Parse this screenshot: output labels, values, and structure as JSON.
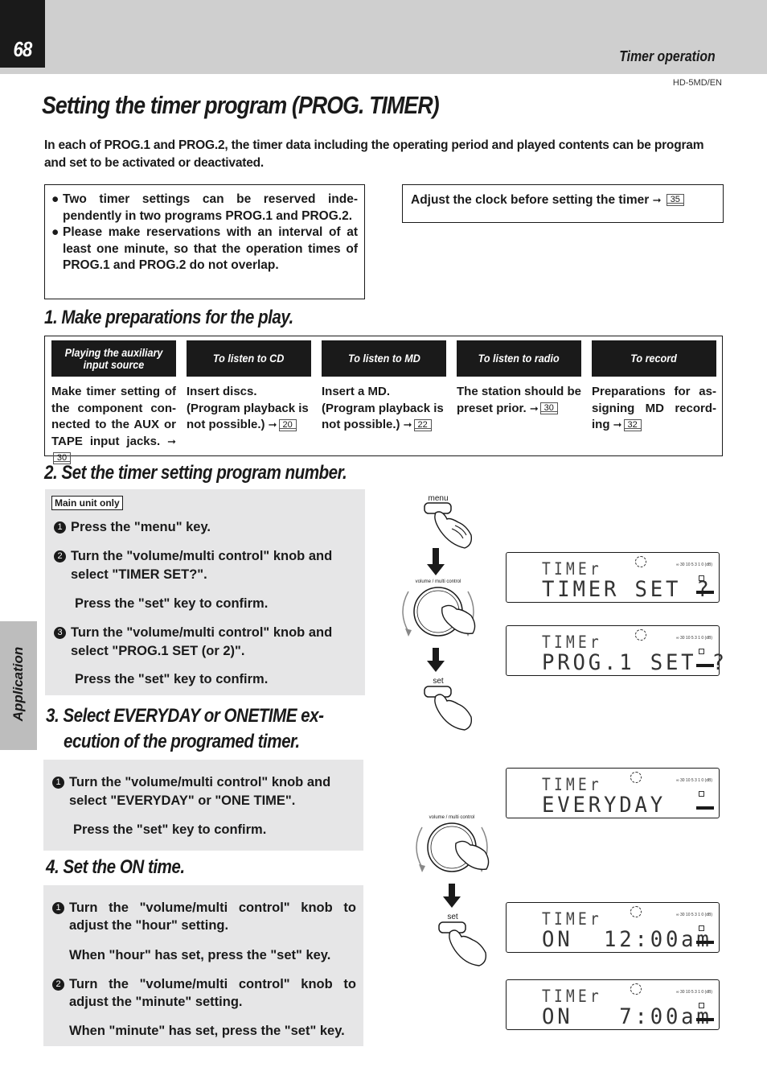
{
  "header": {
    "page_number": "68",
    "section": "Timer operation",
    "model_code": "HD-5MD/EN"
  },
  "title": "Setting the timer program (PROG. TIMER)",
  "intro": "In each of PROG.1 and PROG.2, the timer data including the operating period and played contents can be program and set to be activated or deactivated.",
  "notes": [
    "Two timer settings can be reserved independently in two programs PROG.1 and PROG.2.",
    "Please make reservations with an interval of at least one minute, so that the operation times of PROG.1 and PROG.2 do not overlap."
  ],
  "notes_display": [
    "Two timer settings can be reserved inde-pendently in two programs PROG.1 and PROG.2.",
    "Please make reservations with an interval of at least one minute, so that the operation times of PROG.1 and PROG.2 do not overlap."
  ],
  "clock_note": {
    "text": "Adjust the clock before setting the timer",
    "page_ref": "35"
  },
  "step1": {
    "heading": "1. Make preparations for the play.",
    "columns": [
      {
        "header": "Playing the auxiliary input source",
        "body": "Make timer setting of the component con-nected to the AUX or TAPE input jacks.",
        "page_ref": "30"
      },
      {
        "header": "To listen to CD",
        "body": "Insert discs. (Program playback is not possible.)",
        "page_ref": "20"
      },
      {
        "header": "To listen to MD",
        "body": "Insert a MD. (Program playback is not possible.)",
        "page_ref": "22"
      },
      {
        "header": "To listen to radio",
        "body": "The station should be preset prior.",
        "page_ref": "30"
      },
      {
        "header": "To record",
        "body": "Preparations for as-signing MD record-ing",
        "page_ref": "32"
      }
    ]
  },
  "step2": {
    "heading": "2. Set the timer setting program number.",
    "tag": "Main unit only",
    "items": [
      {
        "num": "1",
        "text": "Press the \"menu\" key."
      },
      {
        "num": "2",
        "text_l1": "Turn the \"volume/multi control\" knob and",
        "text_l2": "select \"TIMER SET?\".",
        "confirm": "Press the \"set\" key to confirm."
      },
      {
        "num": "3",
        "text_l1": "Turn the \"volume/multi control\" knob and",
        "text_l2": "select \"PROG.1 SET (or 2)\".",
        "confirm": "Press the \"set\" key to confirm."
      }
    ]
  },
  "step3": {
    "heading_l1": "3. Select EVERYDAY  or ONETIME ex-",
    "heading_l2": "ecution of the programed timer.",
    "items": [
      {
        "num": "1",
        "text_l1": "Turn the \"volume/multi control\" knob and",
        "text_l2": "select \"EVERYDAY\" or \"ONE TIME\".",
        "confirm": "Press the \"set\" key to confirm."
      }
    ]
  },
  "step4": {
    "heading": "4. Set the ON time.",
    "items": [
      {
        "num": "1",
        "text_l1": "Turn the \"volume/multi control\" knob to",
        "text_l2": "adjust the \"hour\" setting.",
        "confirm": "When \"hour\" has set, press the \"set\" key."
      },
      {
        "num": "2",
        "text_l1": "Turn the \"volume/multi control\" knob to",
        "text_l2": "adjust the \"minute\" setting.",
        "confirm": "When \"minute\" has set, press the \"set\" key."
      }
    ]
  },
  "side_tab": "Application",
  "illustrations": {
    "menu_key_label": "menu",
    "knob_label": "volume / multi control",
    "set_key_label": "set",
    "level_scale": "∞ 30 10 5 3 1 0 (dB)",
    "displays": [
      {
        "line1": "TIMEr",
        "line2": "TIMER SET ?"
      },
      {
        "line1": "TIMEr",
        "line2": "PROG.1 SET ?"
      },
      {
        "line1": "TIMEr",
        "line2": "EVERYDAY"
      },
      {
        "line1": "TIMEr",
        "line2": "ON  12:00am"
      },
      {
        "line1": "TIMEr",
        "line2": "ON   7:00am"
      }
    ]
  },
  "symbols": {
    "bullet": "●",
    "arrow": "➞"
  }
}
